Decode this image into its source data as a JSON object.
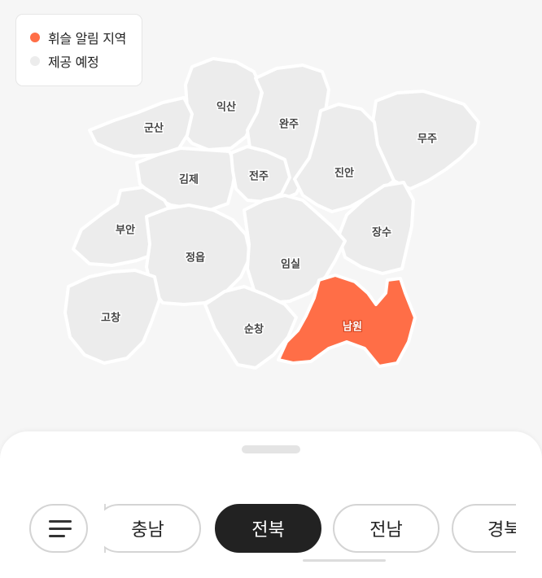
{
  "legend": {
    "items": [
      {
        "label": "휘슬 알림 지역",
        "color": "#ff6e47"
      },
      {
        "label": "제공 예정",
        "color": "#ececec"
      }
    ]
  },
  "map": {
    "regions": [
      {
        "name": "익산",
        "active": false
      },
      {
        "name": "군산",
        "active": false
      },
      {
        "name": "완주",
        "active": false
      },
      {
        "name": "무주",
        "active": false
      },
      {
        "name": "김제",
        "active": false
      },
      {
        "name": "전주",
        "active": false
      },
      {
        "name": "진안",
        "active": false
      },
      {
        "name": "부안",
        "active": false
      },
      {
        "name": "장수",
        "active": false
      },
      {
        "name": "정읍",
        "active": false
      },
      {
        "name": "임실",
        "active": false
      },
      {
        "name": "고창",
        "active": false
      },
      {
        "name": "순창",
        "active": false
      },
      {
        "name": "남원",
        "active": true
      }
    ],
    "inactive_color": "#ececec",
    "active_color": "#ff6e47"
  },
  "bottom_sheet": {
    "filter_icon": "filter-lines-icon",
    "chips": [
      {
        "label": "충남",
        "selected": false
      },
      {
        "label": "전북",
        "selected": true
      },
      {
        "label": "전남",
        "selected": false
      },
      {
        "label": "경북",
        "selected": false
      }
    ]
  }
}
